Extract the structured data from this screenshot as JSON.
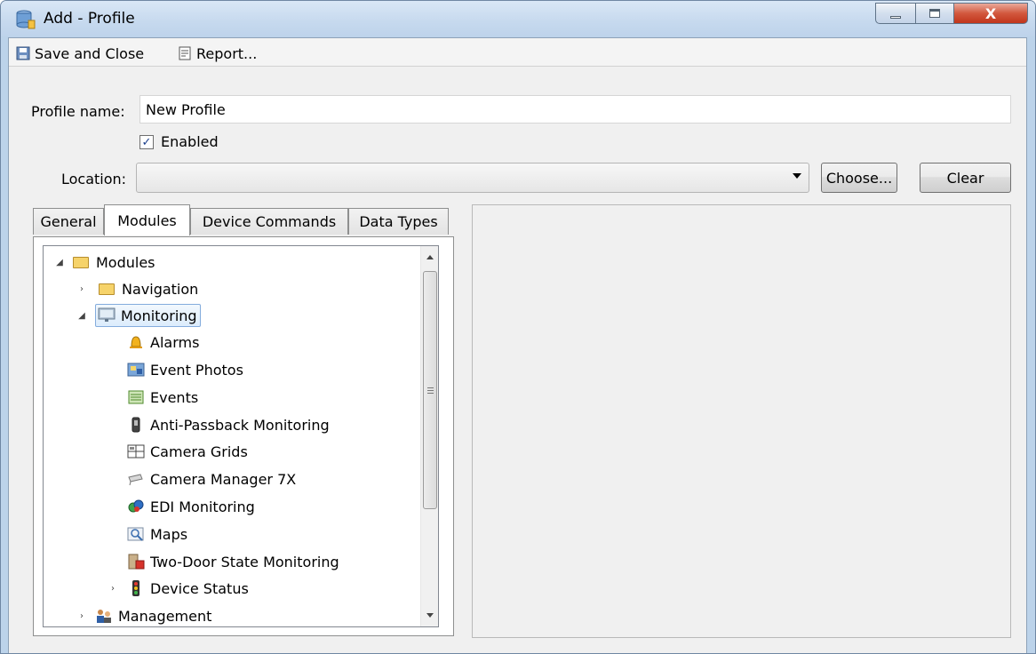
{
  "window": {
    "title": "Add - Profile",
    "close_glyph": "X"
  },
  "toolbar": {
    "save_label": "Save and Close",
    "report_label": "Report..."
  },
  "form": {
    "profile_name_label": "Profile name:",
    "profile_name_value": "New Profile",
    "enabled_label": "Enabled",
    "enabled_checked": true,
    "location_label": "Location:",
    "location_value": "",
    "choose_label": "Choose...",
    "clear_label": "Clear"
  },
  "tabs": [
    {
      "label": "General",
      "active": false
    },
    {
      "label": "Modules",
      "active": true
    },
    {
      "label": "Device Commands",
      "active": false
    },
    {
      "label": "Data Types",
      "active": false
    }
  ],
  "tree": {
    "root": {
      "label": "Modules",
      "expanded": true,
      "icon": "folder-icon"
    },
    "navigation": {
      "label": "Navigation",
      "expanded": false,
      "icon": "folder-icon"
    },
    "monitoring": {
      "label": "Monitoring",
      "expanded": true,
      "selected": true,
      "icon": "monitor-icon"
    },
    "children": [
      {
        "label": "Alarms",
        "icon": "bell-icon"
      },
      {
        "label": "Event Photos",
        "icon": "photo-icon"
      },
      {
        "label": "Events",
        "icon": "events-icon"
      },
      {
        "label": "Anti-Passback Monitoring",
        "icon": "passback-icon"
      },
      {
        "label": "Camera Grids",
        "icon": "grid-icon"
      },
      {
        "label": "Camera Manager 7X",
        "icon": "camera-icon"
      },
      {
        "label": "EDI Monitoring",
        "icon": "edi-icon"
      },
      {
        "label": "Maps",
        "icon": "map-icon"
      },
      {
        "label": "Two-Door State Monitoring",
        "icon": "door-icon"
      }
    ],
    "device_status": {
      "label": "Device Status",
      "expanded": false,
      "icon": "traffic-light-icon"
    },
    "management": {
      "label": "Management",
      "expanded": false,
      "icon": "people-icon"
    }
  },
  "colors": {
    "selection_border": "#84acdd",
    "titlebar": "#c6d9ee",
    "close_button": "#c1351b"
  }
}
